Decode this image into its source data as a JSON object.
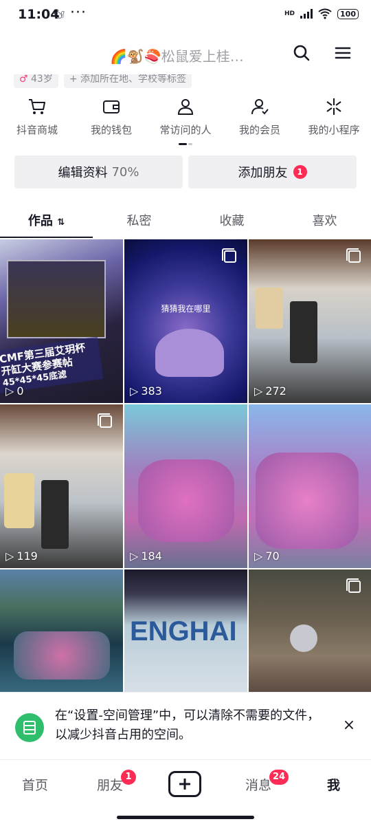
{
  "status_bar": {
    "time": "11:04",
    "dots": "···",
    "network": "HD",
    "battery": "100"
  },
  "header": {
    "nickname": "🌈🐒🍣松鼠爱上桂…"
  },
  "tags": {
    "age": "43岁",
    "add_info": "+ 添加所在地、学校等标签"
  },
  "actions": [
    {
      "label": "抖音商城",
      "icon": "cart-icon"
    },
    {
      "label": "我的钱包",
      "icon": "wallet-icon"
    },
    {
      "label": "常访问的人",
      "icon": "person-icon"
    },
    {
      "label": "我的会员",
      "icon": "member-icon"
    },
    {
      "label": "我的小程序",
      "icon": "miniapp-icon"
    }
  ],
  "buttons": {
    "edit_label": "编辑资料",
    "edit_percent": "70%",
    "add_friend_label": "添加朋友",
    "add_friend_badge": "1"
  },
  "tabs": {
    "works": "作品",
    "private": "私密",
    "favorites": "收藏",
    "likes": "喜欢"
  },
  "grid": [
    {
      "plays": "0",
      "multi": true,
      "overlay_line1": "CMF第三届艾玥杯",
      "overlay_line2": "开缸大赛参赛帖",
      "overlay_line3": "45*45*45底滤"
    },
    {
      "plays": "383",
      "multi": true,
      "caption": "猜猜我在哪里"
    },
    {
      "plays": "272",
      "multi": true
    },
    {
      "plays": "119",
      "multi": true
    },
    {
      "plays": "184",
      "multi": false
    },
    {
      "plays": "70",
      "multi": false
    },
    {
      "plays": "",
      "multi": false
    },
    {
      "plays": "",
      "multi": false
    },
    {
      "plays": "",
      "multi": true
    }
  ],
  "toast": {
    "text": "在“设置-空间管理”中，可以清除不需要的文件，以减少抖音占用的空间。",
    "close": "×"
  },
  "bottom_nav": {
    "home": "首页",
    "friends": "朋友",
    "friends_badge": "1",
    "messages": "消息",
    "messages_badge": "24",
    "me": "我"
  }
}
